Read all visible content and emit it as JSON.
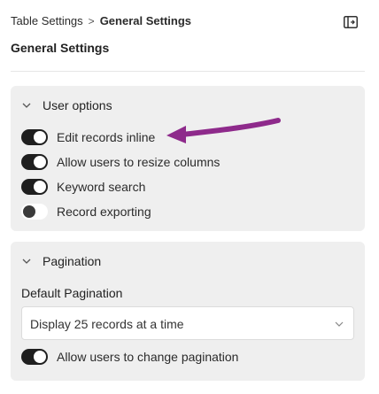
{
  "breadcrumb": {
    "parent": "Table Settings",
    "separator": ">",
    "current": "General Settings"
  },
  "header": {
    "panel_icon": "collapse-panel-icon"
  },
  "page_title": "General Settings",
  "user_options": {
    "title": "User options",
    "expanded": true,
    "toggles": [
      {
        "label": "Edit records inline",
        "on": true
      },
      {
        "label": "Allow users to resize columns",
        "on": true
      },
      {
        "label": "Keyword search",
        "on": true
      },
      {
        "label": "Record exporting",
        "on": false
      }
    ]
  },
  "pagination": {
    "title": "Pagination",
    "expanded": true,
    "default_label": "Default Pagination",
    "select_value": "Display 25 records at a time",
    "toggle": {
      "label": "Allow users to change pagination",
      "on": true
    }
  },
  "colors": {
    "accent_arrow": "#8e2a8b",
    "section_bg": "#efefef",
    "toggle_on": "#1f1f1f"
  }
}
